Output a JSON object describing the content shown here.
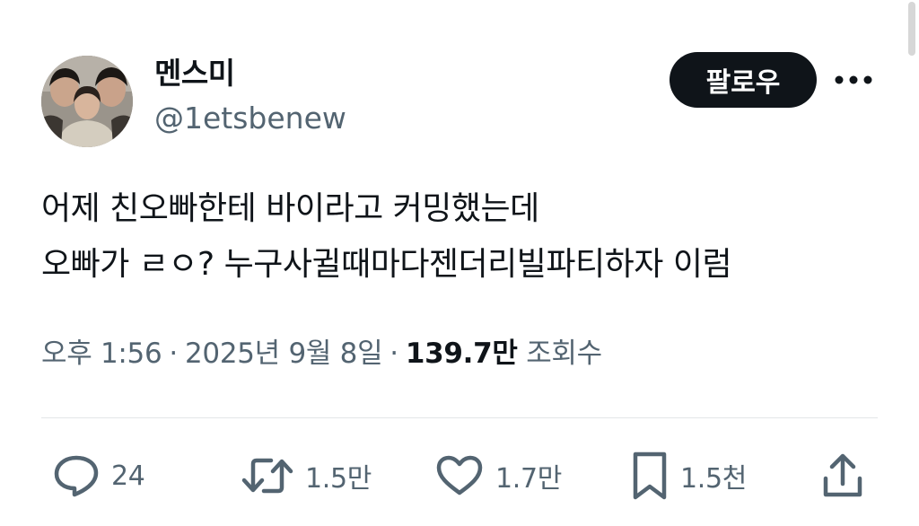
{
  "user": {
    "display_name": "멘스미",
    "handle": "@1etsbenew"
  },
  "follow_label": "팔로우",
  "tweet": {
    "lines": [
      "어제 친오빠한테 바이라고 커밍했는데",
      "오빠가 ㄹㅇ? 누구사귈때마다젠더리빌파티하자 이럼"
    ]
  },
  "meta": {
    "time": "오후 1:56",
    "separator": "·",
    "date": "2025년 9월 8일",
    "views_count": "139.7만",
    "views_label": "조회수"
  },
  "actions": {
    "replies": "24",
    "reposts": "1.5만",
    "likes": "1.7만",
    "bookmarks": "1.5천"
  },
  "icons": {
    "reply": "speech-bubble-icon",
    "repost": "repost-arrows-icon",
    "like": "heart-icon",
    "bookmark": "bookmark-icon",
    "share": "share-upload-icon",
    "more": "more-dots-icon"
  },
  "colors": {
    "text_primary": "#0f1419",
    "text_secondary": "#536471",
    "follow_button_bg": "#0f1419",
    "follow_button_text": "#ffffff",
    "divider": "#e3e6e8"
  }
}
